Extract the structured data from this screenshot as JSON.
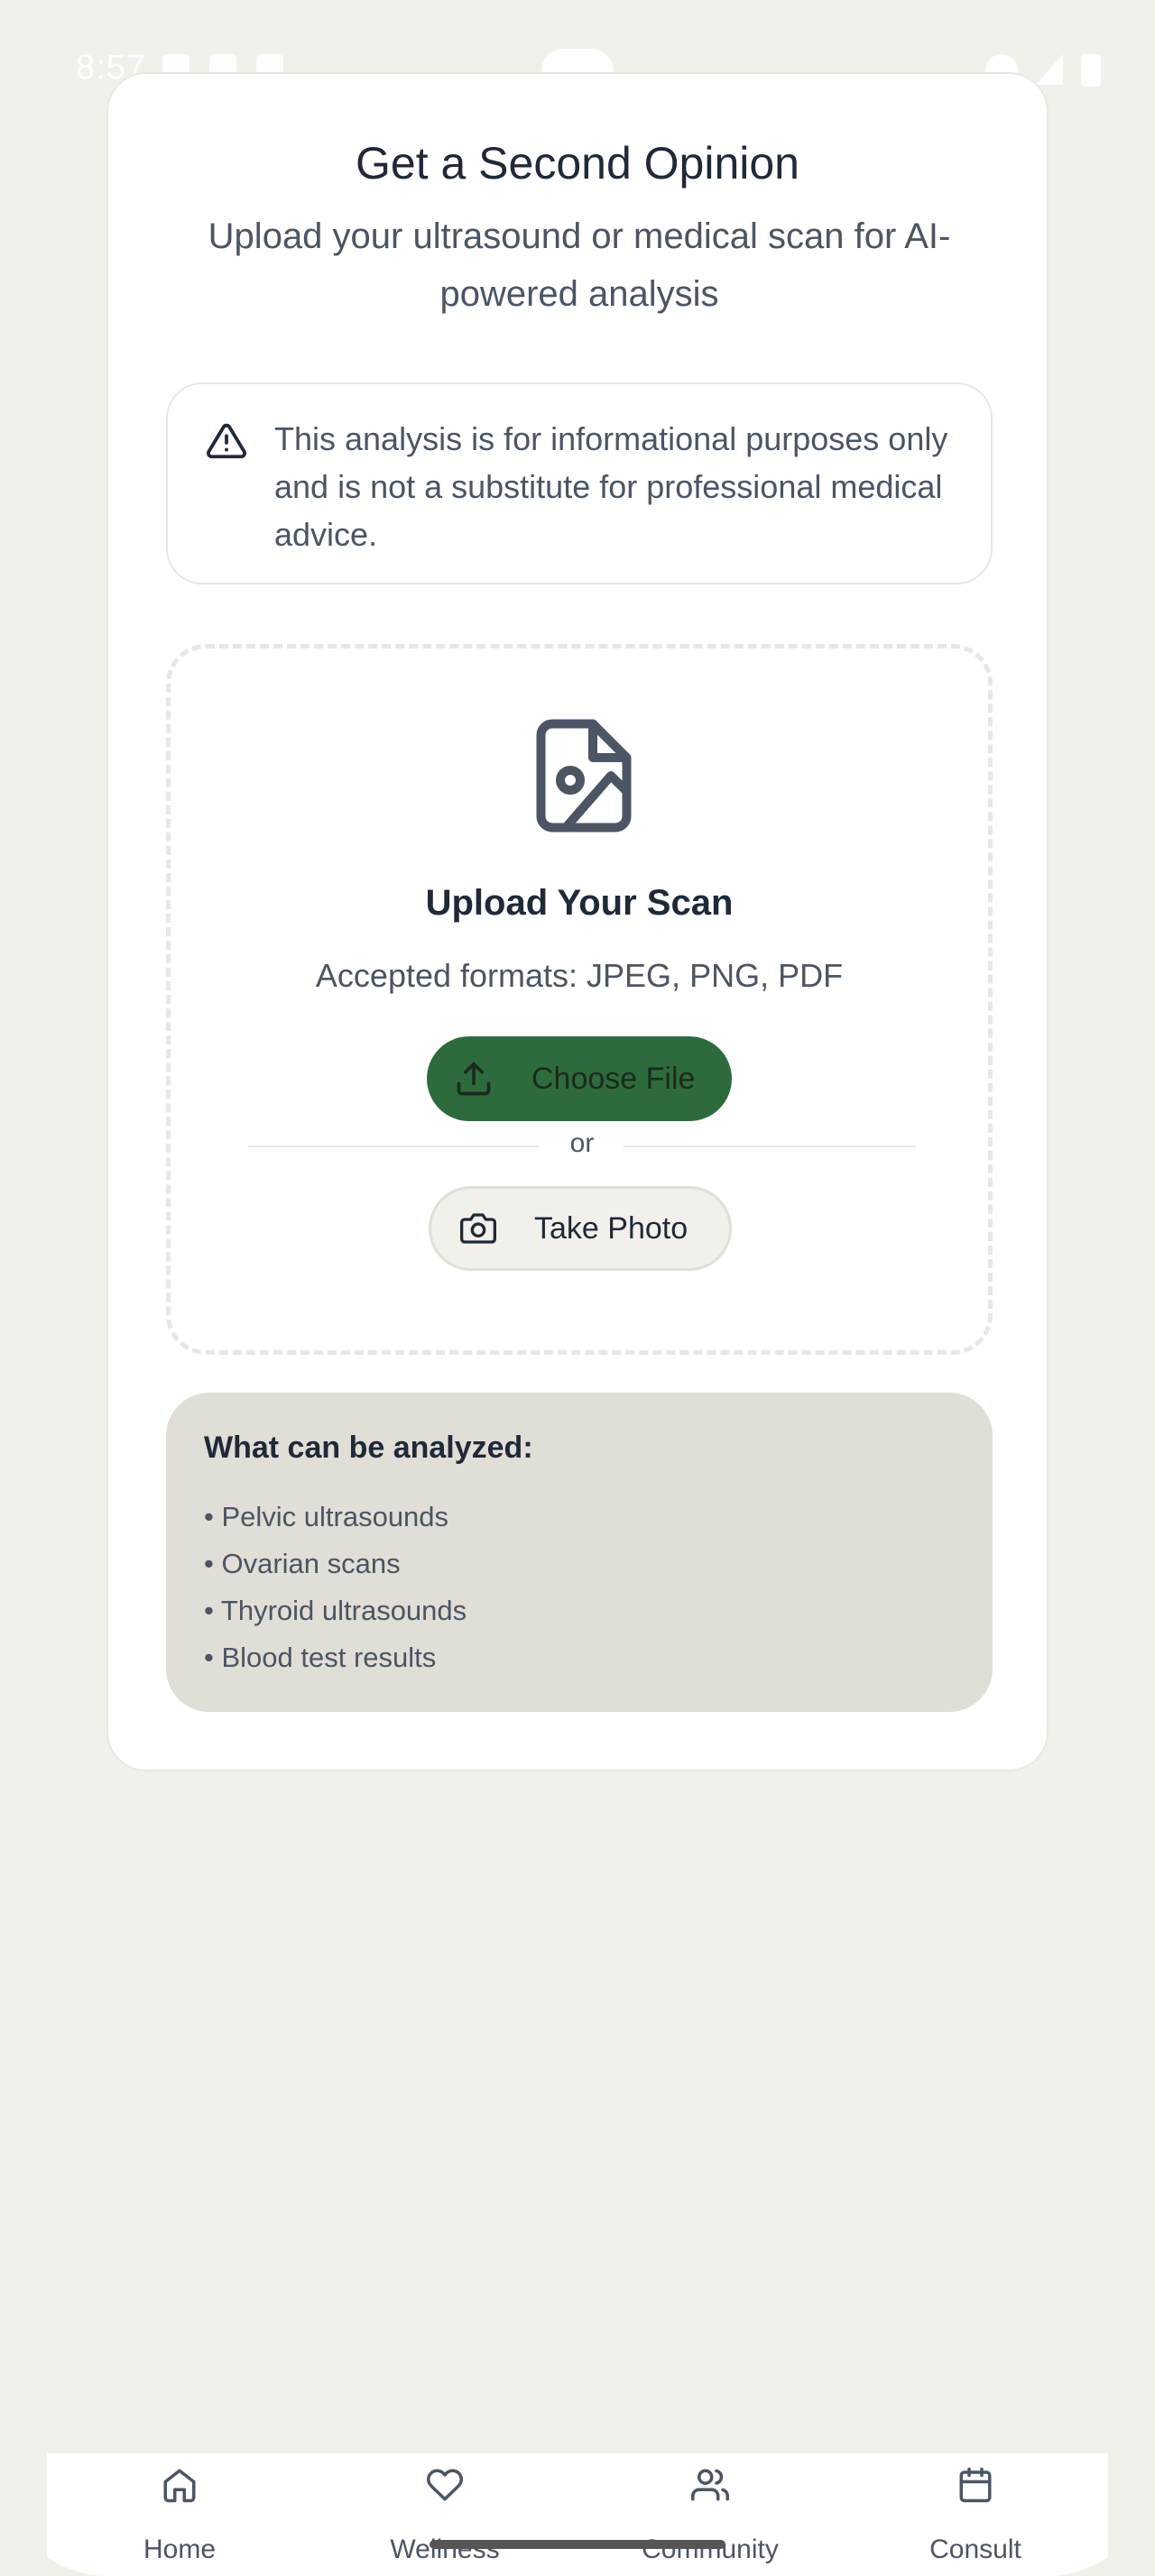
{
  "status_bar": {
    "time": "8:57"
  },
  "card": {
    "title": "Get a Second Opinion",
    "subtitle": "Upload your ultrasound or medical scan for AI-powered analysis",
    "disclaimer": {
      "icon": "warning-icon",
      "text": "This analysis is for informational purposes only and is not a substitute for professional medical advice."
    },
    "upload": {
      "icon": "file-image-icon",
      "title": "Upload Your Scan",
      "formats": "Accepted formats: JPEG, PNG, PDF",
      "choose_file_label": "Choose File",
      "or_label": "or",
      "take_photo_label": "Take Photo"
    },
    "analyzable": {
      "heading": "What can be analyzed:",
      "items": [
        "• Pelvic ultrasounds",
        "• Ovarian scans",
        "• Thyroid ultrasounds",
        "• Blood test results"
      ]
    }
  },
  "bottom_nav": {
    "items": [
      {
        "label": "Home",
        "icon": "home-icon"
      },
      {
        "label": "Wellness",
        "icon": "heart-icon"
      },
      {
        "label": "Community",
        "icon": "users-icon"
      },
      {
        "label": "Consult",
        "icon": "calendar-icon"
      }
    ]
  },
  "colors": {
    "background": "#f2f0eb",
    "primary": "#2e6b3c",
    "info_box": "#e1ddd7"
  }
}
